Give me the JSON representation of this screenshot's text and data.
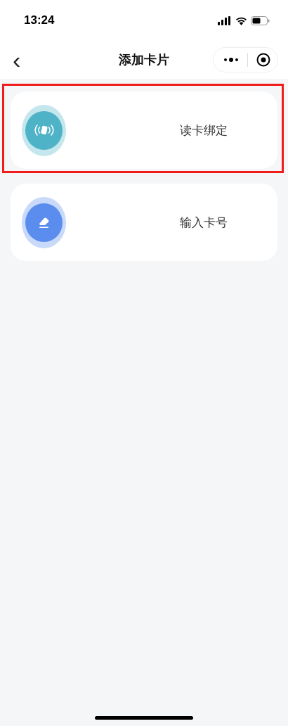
{
  "status_bar": {
    "time": "13:24"
  },
  "nav_bar": {
    "back": "‹",
    "title": "添加卡片"
  },
  "options": [
    {
      "kind": "nfc",
      "label": "读卡绑定",
      "color": "#4fb3c8",
      "highlighted": true
    },
    {
      "kind": "edit",
      "label": "输入卡号",
      "color": "#5b8def",
      "highlighted": false
    }
  ]
}
